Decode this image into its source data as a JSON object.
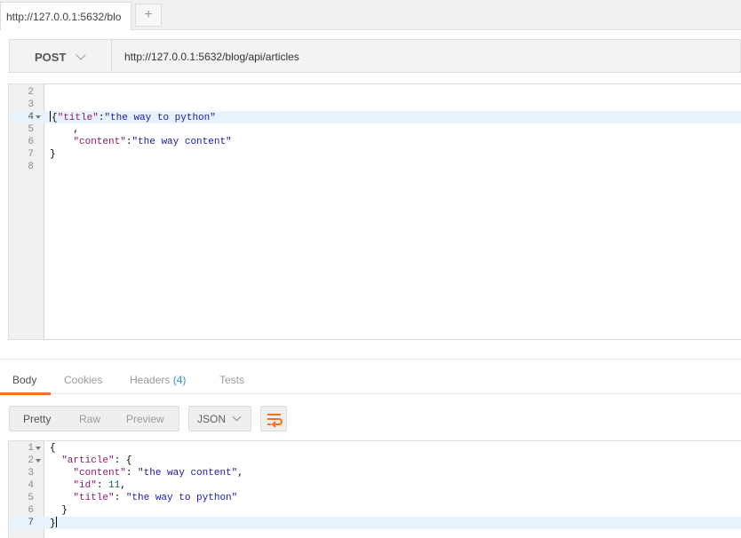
{
  "tabs": {
    "items": [
      {
        "label": "http://127.0.0.1:5632/blo"
      }
    ],
    "add_label": "+"
  },
  "request": {
    "method": "POST",
    "url": "http://127.0.0.1:5632/blog/api/articles"
  },
  "request_body": {
    "lines": [
      {
        "n": "2",
        "text": ""
      },
      {
        "n": "3",
        "text": ""
      },
      {
        "n": "4",
        "text": "{\"title\":\"the way to python\""
      },
      {
        "n": "5",
        "text": "    ,"
      },
      {
        "n": "6",
        "text": "    \"content\":\"the way content\""
      },
      {
        "n": "7",
        "text": "}"
      },
      {
        "n": "8",
        "text": ""
      }
    ]
  },
  "response_tabs": {
    "body": "Body",
    "cookies": "Cookies",
    "headers": "Headers",
    "headers_count": "(4)",
    "tests": "Tests"
  },
  "response_toolbar": {
    "pretty": "Pretty",
    "raw": "Raw",
    "preview": "Preview",
    "format": "JSON",
    "wrap_icon": "wrap-lines-icon"
  },
  "response_body": {
    "lines": [
      {
        "n": "1",
        "text": "{"
      },
      {
        "n": "2",
        "text": "  \"article\": {"
      },
      {
        "n": "3",
        "text": "    \"content\": \"the way content\","
      },
      {
        "n": "4",
        "text": "    \"id\": 11,"
      },
      {
        "n": "5",
        "text": "    \"title\": \"the way to python\""
      },
      {
        "n": "6",
        "text": "  }"
      },
      {
        "n": "7",
        "text": "}"
      }
    ]
  },
  "colors": {
    "accent": "#f47023",
    "link": "#2f8fd6",
    "active_line": "#e8f2fc"
  }
}
